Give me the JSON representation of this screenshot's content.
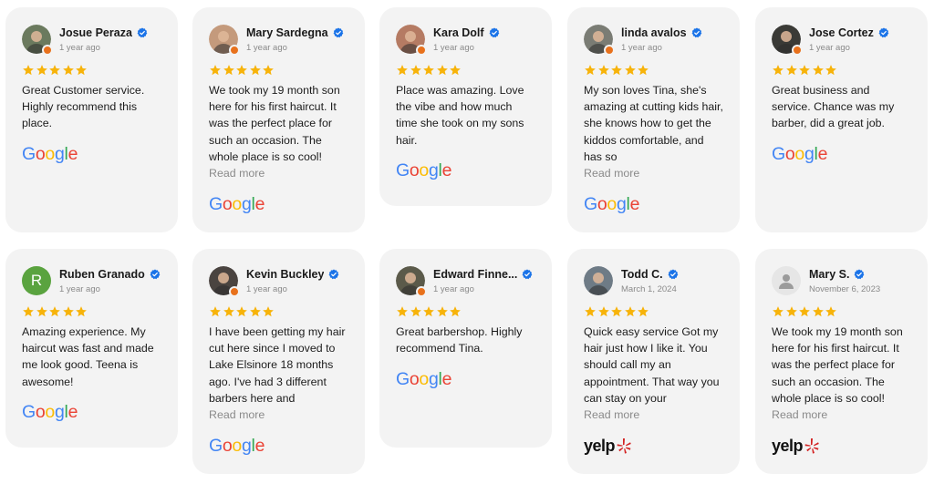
{
  "reviews": [
    {
      "name": "Josue Peraza",
      "date": "1 year ago",
      "text": "Great Customer service. Highly recommend this place.",
      "more": "",
      "source": "google",
      "avatar": "photo",
      "avatar_color": "#6b7a5e"
    },
    {
      "name": "Mary Sardegna",
      "date": "1 year ago",
      "text": "We took my 19 month son here for his first haircut. It was the perfect place for such an occasion. The whole place is so cool!",
      "more": "Read more",
      "source": "google",
      "avatar": "photo",
      "avatar_color": "#c49a7c"
    },
    {
      "name": "Kara Dolf",
      "date": "1 year ago",
      "text": "Place was amazing. Love the vibe and how much time she took on my sons hair.",
      "more": "",
      "source": "google",
      "avatar": "photo",
      "avatar_color": "#b57b63"
    },
    {
      "name": "linda avalos",
      "date": "1 year ago",
      "text": "My son loves Tina, she's amazing at cutting kids hair, she knows how to get the kiddos comfortable, and has so",
      "more": "Read more",
      "source": "google",
      "avatar": "photo",
      "avatar_color": "#7a7c74"
    },
    {
      "name": "Jose Cortez",
      "date": "1 year ago",
      "text": "Great business and service. Chance was my barber, did a great job.",
      "more": "",
      "source": "google",
      "avatar": "photo",
      "avatar_color": "#3a3a36"
    },
    {
      "name": "Ruben Granado",
      "date": "1 year ago",
      "text": "Amazing experience. My haircut was fast and made me look good. Teena is awesome!",
      "more": "",
      "source": "google",
      "avatar": "letter",
      "avatar_letter": "R",
      "avatar_color": "#5aa33f"
    },
    {
      "name": "Kevin Buckley",
      "date": "1 year ago",
      "text": "I have been getting my hair cut here since I moved to Lake Elsinore 18 months ago. I've had 3 different barbers here and",
      "more": "Read more",
      "source": "google",
      "avatar": "photo",
      "avatar_color": "#4a4440"
    },
    {
      "name": "Edward Finne...",
      "date": "1 year ago",
      "text": "Great barbershop. Highly recommend Tina.",
      "more": "",
      "source": "google",
      "avatar": "photo",
      "avatar_color": "#5b5a4a"
    },
    {
      "name": "Todd C.",
      "date": "March 1, 2024",
      "text": "Quick easy service Got my hair just how I like it. You should call my an appointment. That way you can stay on your",
      "more": "Read more",
      "source": "yelp",
      "avatar": "photo",
      "avatar_color": "#6e7b86"
    },
    {
      "name": "Mary S.",
      "date": "November 6, 2023",
      "text": "We took my 19 month son here for his first haircut. It was the perfect place for such an occasion. The whole place is so cool!",
      "more": "Read more",
      "source": "yelp",
      "avatar": "generic",
      "avatar_color": "#e6e6e6"
    }
  ],
  "brands": {
    "google": {
      "letters": [
        "G",
        "o",
        "o",
        "g",
        "l",
        "e"
      ],
      "colors": [
        "#4285F4",
        "#EA4335",
        "#FBBC05",
        "#4285F4",
        "#34A853",
        "#EA4335"
      ]
    },
    "yelp": {
      "word": "yelp",
      "burst_color": "#d32323"
    }
  },
  "colors": {
    "star": "#f7b30a",
    "verified": "#1a73e8",
    "card_bg": "#f3f3f3"
  },
  "rating": 5
}
